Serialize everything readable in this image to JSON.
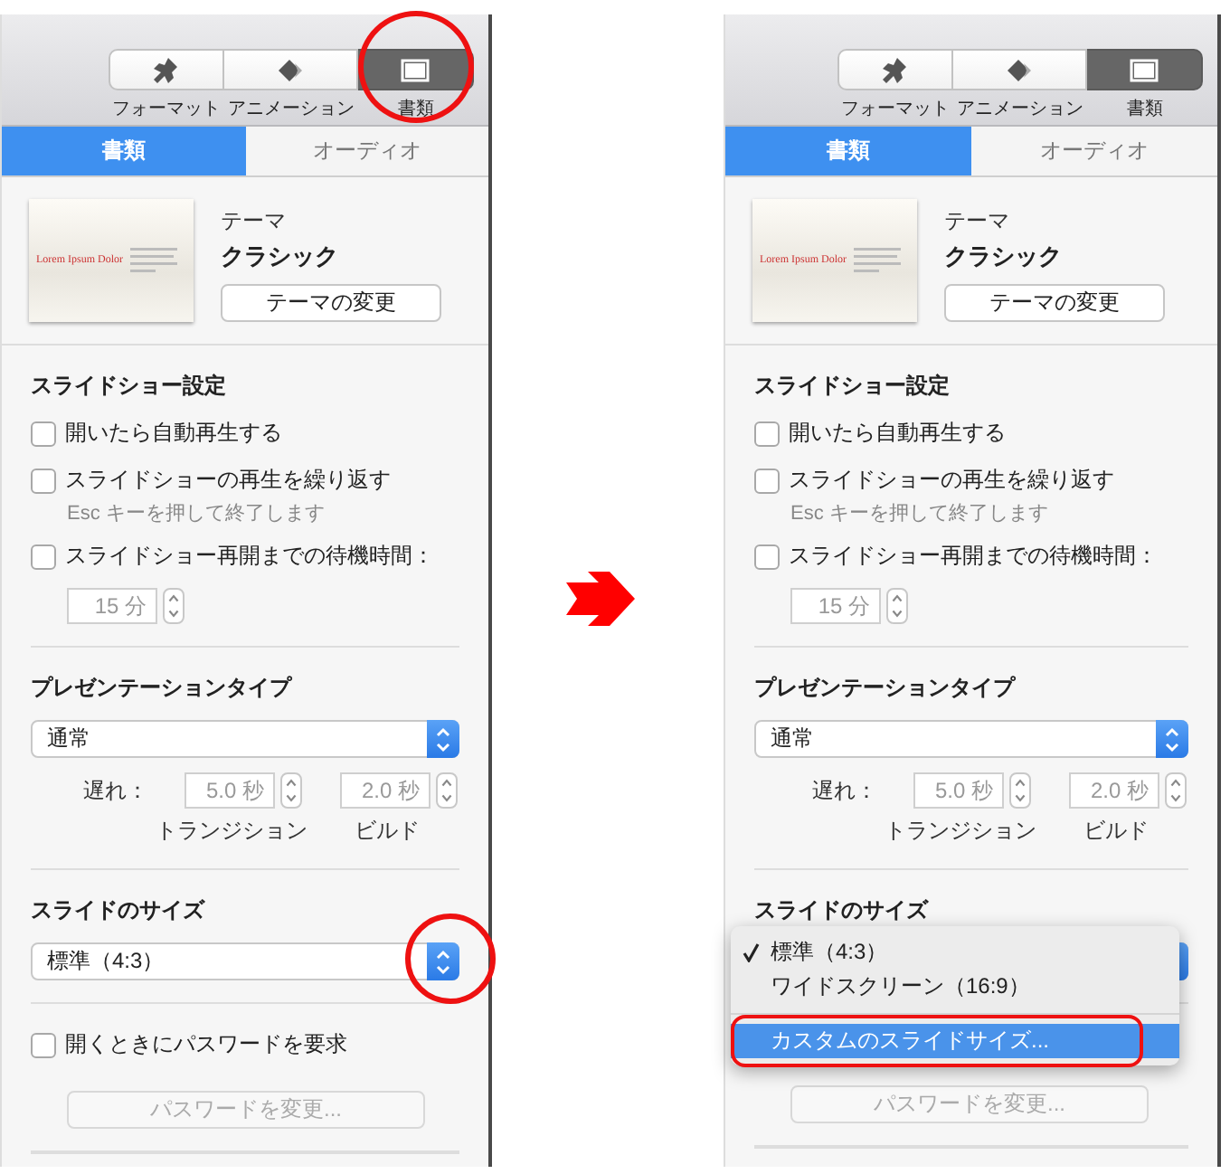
{
  "panels": [
    {
      "toolbar": [
        {
          "label": "フォーマット",
          "selected": false,
          "circled": false
        },
        {
          "label": "アニメーション",
          "selected": false,
          "circled": false
        },
        {
          "label": "書類",
          "selected": true,
          "circled": true
        }
      ],
      "tabs": [
        {
          "label": "書類",
          "selected": true
        },
        {
          "label": "オーディオ",
          "selected": false
        }
      ],
      "theme": {
        "thumbnail_title": "Lorem Ipsum Dolor",
        "label": "テーマ",
        "name": "クラシック",
        "button": "テーマの変更"
      },
      "slideshow": {
        "heading": "スライドショー設定",
        "options": [
          {
            "label": "開いたら自動再生する",
            "checked": false
          },
          {
            "label": "スライドショーの再生を繰り返す",
            "checked": false,
            "hint": "Esc キーを押して終了します"
          },
          {
            "label": "スライドショー再開までの待機時間：",
            "checked": false
          }
        ],
        "wait": "15 分"
      },
      "presentation": {
        "heading": "プレゼンテーションタイプ",
        "value": "通常",
        "delay_label": "遅れ：",
        "transition": "5.0 秒",
        "transition_label": "トランジション",
        "build": "2.0 秒",
        "build_label": "ビルド"
      },
      "slide_size": {
        "heading": "スライドのサイズ",
        "value": "標準（4:3）",
        "circled": true
      },
      "password": {
        "checked": false,
        "label": "開くときにパスワードを要求",
        "button": "パスワードを変更..."
      }
    },
    {
      "toolbar": [
        {
          "label": "フォーマット",
          "selected": false
        },
        {
          "label": "アニメーション",
          "selected": false
        },
        {
          "label": "書類",
          "selected": true
        }
      ],
      "tabs": [
        {
          "label": "書類",
          "selected": true
        },
        {
          "label": "オーディオ",
          "selected": false
        }
      ],
      "theme": {
        "thumbnail_title": "Lorem Ipsum Dolor",
        "label": "テーマ",
        "name": "クラシック",
        "button": "テーマの変更"
      },
      "slideshow": {
        "heading": "スライドショー設定",
        "options": [
          {
            "label": "開いたら自動再生する",
            "checked": false
          },
          {
            "label": "スライドショーの再生を繰り返す",
            "checked": false,
            "hint": "Esc キーを押して終了します"
          },
          {
            "label": "スライドショー再開までの待機時間：",
            "checked": false
          }
        ],
        "wait": "15 分"
      },
      "presentation": {
        "heading": "プレゼンテーションタイプ",
        "value": "通常",
        "delay_label": "遅れ：",
        "transition": "5.0 秒",
        "transition_label": "トランジション",
        "build": "2.0 秒",
        "build_label": "ビルド"
      },
      "slide_size": {
        "heading": "スライドのサイズ",
        "menu": [
          {
            "kind": "option",
            "label": "標準（4:3）",
            "selected": true,
            "highlighted": false
          },
          {
            "kind": "option",
            "label": "ワイドスクリーン（16:9）",
            "selected": false,
            "highlighted": false
          },
          {
            "kind": "separator"
          },
          {
            "kind": "option",
            "label": "カスタムのスライドサイズ...",
            "selected": false,
            "highlighted": true,
            "circled": true
          }
        ]
      },
      "password": {
        "button": "パスワードを変更..."
      }
    }
  ]
}
